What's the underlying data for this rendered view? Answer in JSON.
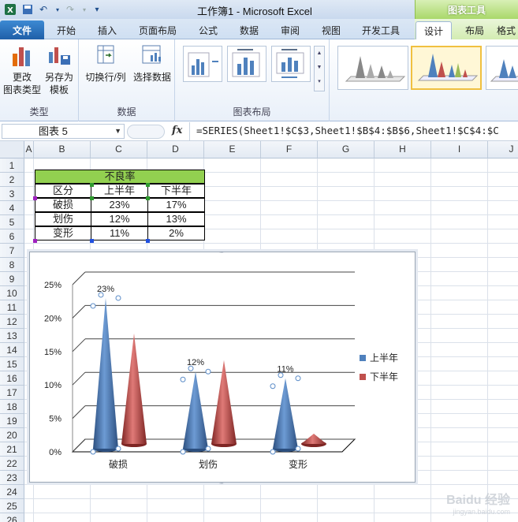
{
  "title_bar": {
    "app_title": "工作簿1 - Microsoft Excel",
    "context_tab_header": "图表工具"
  },
  "tabs": [
    "文件",
    "开始",
    "插入",
    "页面布局",
    "公式",
    "数据",
    "审阅",
    "视图",
    "开发工具",
    "设计",
    "布局",
    "格式"
  ],
  "active_tab": "设计",
  "ribbon": {
    "group_type": {
      "label": "类型",
      "change_type": [
        "更改",
        "图表类型"
      ],
      "save_template": [
        "另存为",
        "模板"
      ]
    },
    "group_data": {
      "label": "数据",
      "switch_row_col": "切换行/列",
      "select_data": "选择数据"
    },
    "group_layout": {
      "label": "图表布局"
    }
  },
  "formula_bar": {
    "name_box": "图表 5",
    "fx": "fx",
    "formula": "=SERIES(Sheet1!$C$3,Sheet1!$B$4:$B$6,Sheet1!$C$4:$C"
  },
  "sheet": {
    "columns": [
      "A",
      "B",
      "C",
      "D",
      "E",
      "F",
      "G",
      "H",
      "I",
      "J"
    ],
    "rows": [
      "1",
      "2",
      "3",
      "4",
      "5",
      "6",
      "7",
      "8",
      "9",
      "10",
      "11",
      "12",
      "13",
      "14",
      "15",
      "16",
      "17",
      "18",
      "19",
      "20",
      "21",
      "22",
      "23",
      "24",
      "25",
      "26"
    ],
    "table": {
      "title": "不良率",
      "header": [
        "区分",
        "上半年",
        "下半年"
      ],
      "rows": [
        [
          "破损",
          "23%",
          "17%"
        ],
        [
          "划伤",
          "12%",
          "13%"
        ],
        [
          "变形",
          "11%",
          "2%"
        ]
      ]
    }
  },
  "chart_data": {
    "type": "bar",
    "subtype": "3d-cone-column",
    "categories": [
      "破损",
      "划伤",
      "变形"
    ],
    "series": [
      {
        "name": "上半年",
        "values": [
          23,
          12,
          11
        ],
        "color": "#4f81bd"
      },
      {
        "name": "下半年",
        "values": [
          17,
          13,
          2
        ],
        "color": "#c0504d"
      }
    ],
    "data_labels": [
      "23%",
      "12%",
      "11%"
    ],
    "y_ticks": [
      "0%",
      "5%",
      "10%",
      "15%",
      "20%",
      "25%"
    ],
    "ylim": [
      0,
      25
    ],
    "grid": true,
    "legend": "right"
  },
  "watermark": {
    "main": "Baidu 经验",
    "sub": "jingyan.baidu.com"
  },
  "colors": {
    "accent_blue": "#2b579a",
    "context_green": "#92d050"
  }
}
